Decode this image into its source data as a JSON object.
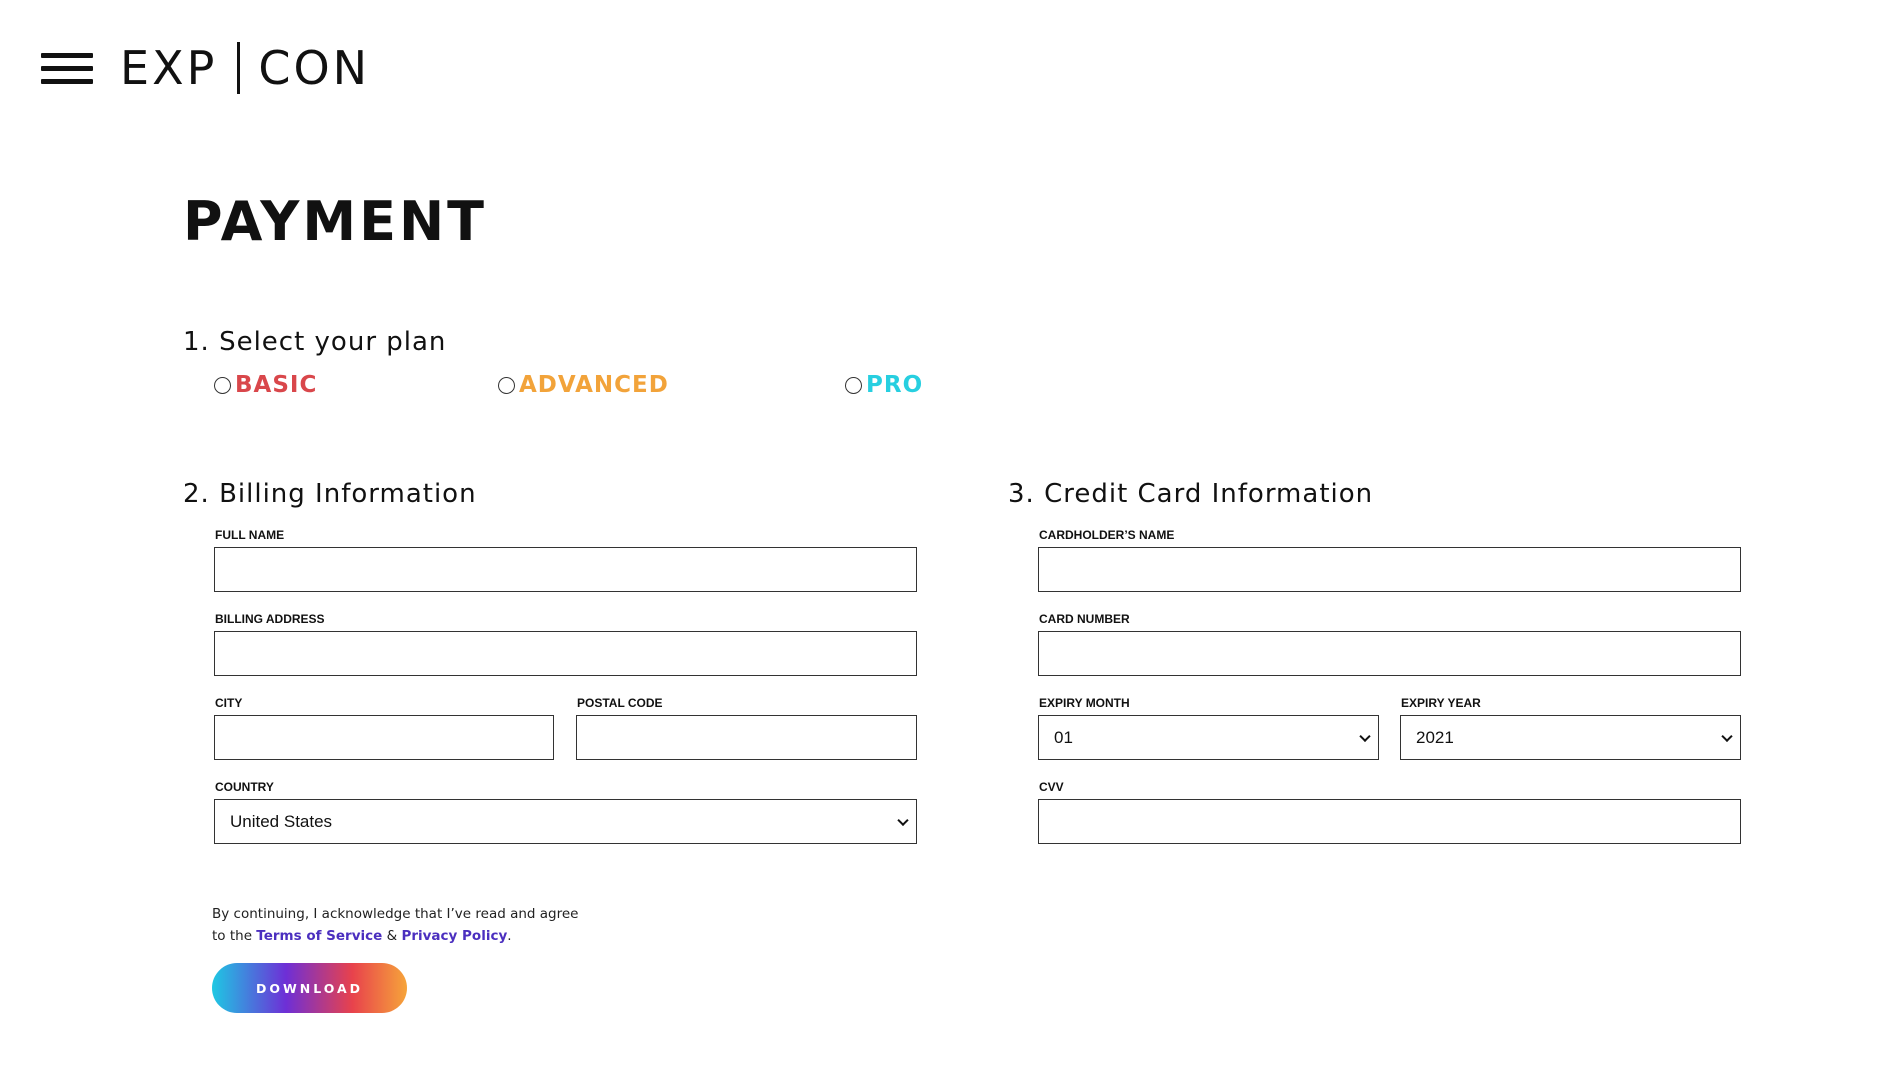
{
  "header": {
    "logo_left": "EXP",
    "logo_right": "CON"
  },
  "page": {
    "title": "PAYMENT"
  },
  "plan_section": {
    "heading": "1. Select your plan",
    "plans": [
      {
        "label": "BASIC",
        "color": "#d9474b",
        "selected": false
      },
      {
        "label": "ADVANCED",
        "color": "#f2a33a",
        "selected": false
      },
      {
        "label": "PRO",
        "color": "#27cfe0",
        "selected": false
      }
    ]
  },
  "billing": {
    "heading": "2. Billing Information",
    "full_name_label": "FULL NAME",
    "full_name_value": "",
    "address_label": "BILLING ADDRESS",
    "address_value": "",
    "city_label": "CITY",
    "city_value": "",
    "postal_label": "POSTAL CODE",
    "postal_value": "",
    "country_label": "COUNTRY",
    "country_value": "United States"
  },
  "card": {
    "heading": "3. Credit Card Information",
    "holder_label": "CARDHOLDER’S NAME",
    "holder_value": "",
    "number_label": "CARD NUMBER",
    "number_value": "",
    "month_label": "EXPIRY MONTH",
    "month_value": "01",
    "year_label": "EXPIRY YEAR",
    "year_value": "2021",
    "cvv_label": "CVV",
    "cvv_value": ""
  },
  "agreement": {
    "line1": "By continuing, I acknowledge that I’ve read and agree",
    "line2_prefix": "to the",
    "terms_link": "Terms of Service",
    "ampersand": "&",
    "privacy_link": "Privacy Policy",
    "period": "."
  },
  "actions": {
    "download_label": "DOWNLOAD"
  },
  "colors": {
    "link": "#4b2fbf",
    "basic": "#d9474b",
    "advanced": "#f2a33a",
    "pro": "#27cfe0"
  }
}
